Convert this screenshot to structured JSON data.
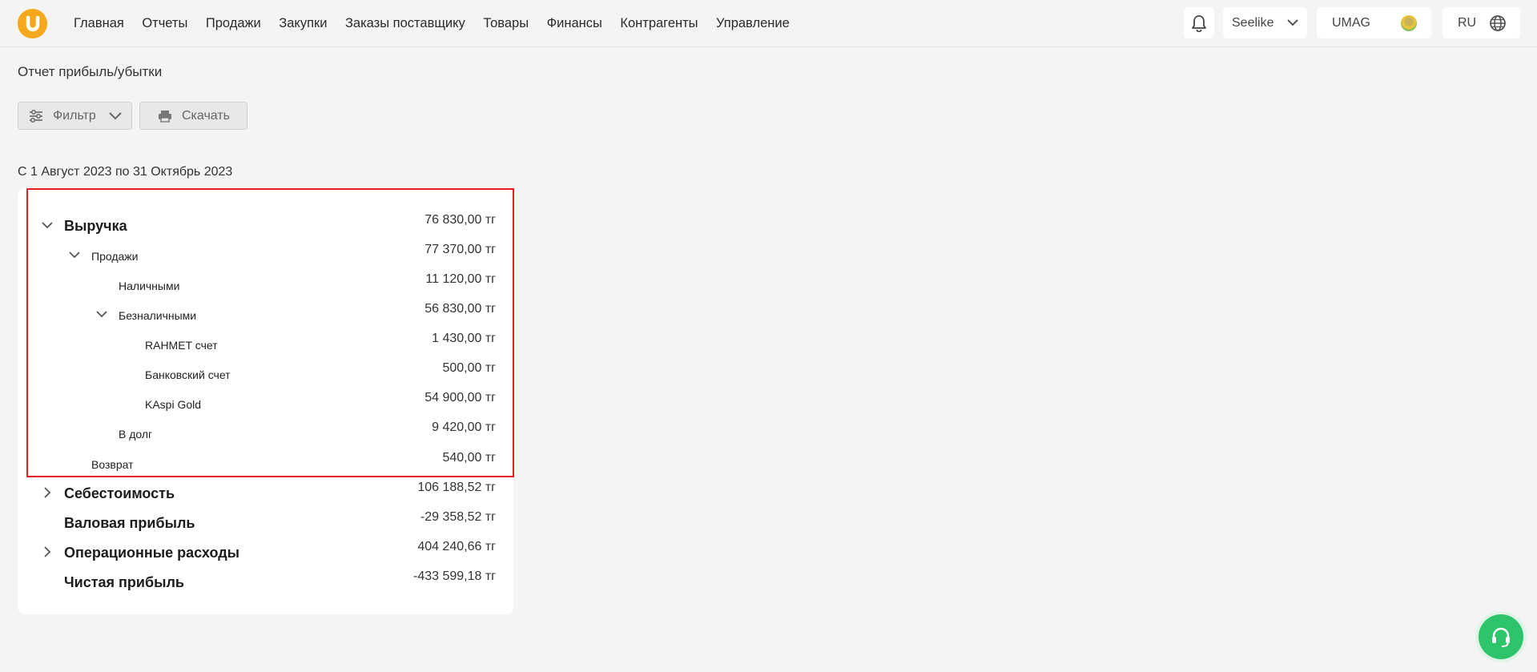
{
  "nav": {
    "items": [
      "Главная",
      "Отчеты",
      "Продажи",
      "Закупки",
      "Заказы поставщику",
      "Товары",
      "Финансы",
      "Контрагенты",
      "Управление"
    ]
  },
  "header": {
    "user": "Seelike",
    "org": "UMAG",
    "lang": "RU"
  },
  "page": {
    "title": "Отчет прибыль/убытки",
    "filter_label": "Фильтр",
    "download_label": "Скачать",
    "period": "С 1 Август 2023 по 31 Октябрь 2023"
  },
  "report": {
    "rows": [
      {
        "label": "Выручка",
        "amount": "76 830,00 тг"
      },
      {
        "label": "Продажи",
        "amount": "77 370,00 тг"
      },
      {
        "label": "Наличными",
        "amount": "11 120,00 тг"
      },
      {
        "label": "Безналичными",
        "amount": "56 830,00 тг"
      },
      {
        "label": "RAHMET счет",
        "amount": "1 430,00 тг"
      },
      {
        "label": "Банковский счет",
        "amount": "500,00 тг"
      },
      {
        "label": "KAspi Gold",
        "amount": "54 900,00 тг"
      },
      {
        "label": "В долг",
        "amount": "9 420,00 тг"
      },
      {
        "label": "Возврат",
        "amount": "540,00 тг"
      },
      {
        "label": "Себестоимость",
        "amount": "106 188,52 тг"
      },
      {
        "label": "Валовая прибыль",
        "amount": "-29 358,52 тг"
      },
      {
        "label": "Операционные расходы",
        "amount": "404 240,66 тг"
      },
      {
        "label": "Чистая прибыль",
        "amount": "-433 599,18 тг"
      }
    ]
  },
  "colors": {
    "brand": "#f6a81c",
    "highlight": "#e31e24",
    "support": "#2ec46b"
  },
  "icons": [
    "logo-icon",
    "bell-icon",
    "chevron-down-icon",
    "globe-icon",
    "sliders-icon",
    "printer-icon",
    "chevron-right-icon",
    "headset-icon"
  ]
}
